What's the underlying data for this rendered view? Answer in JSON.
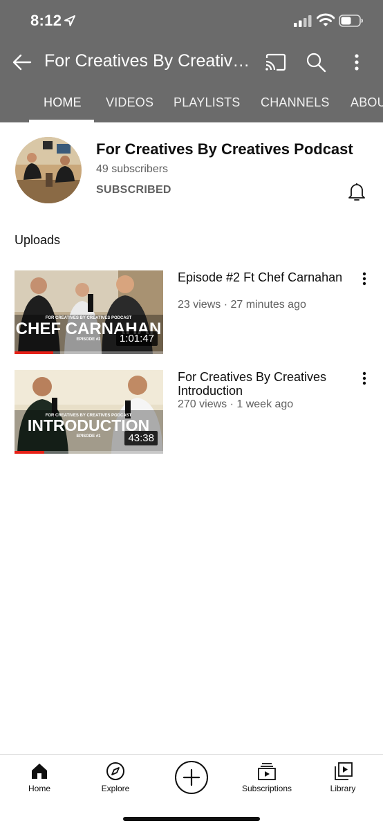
{
  "status_bar": {
    "time": "8:12"
  },
  "app_bar": {
    "title": "For Creatives By Creatives Podcast"
  },
  "tabs": [
    {
      "label": "HOME",
      "active": true
    },
    {
      "label": "VIDEOS",
      "active": false
    },
    {
      "label": "PLAYLISTS",
      "active": false
    },
    {
      "label": "CHANNELS",
      "active": false
    },
    {
      "label": "ABOUT",
      "active": false
    }
  ],
  "channel": {
    "name": "For Creatives By Creatives Podcast",
    "subscribers": "49 subscribers",
    "subscribe_state": "SUBSCRIBED"
  },
  "section": {
    "uploads_label": "Uploads"
  },
  "videos": [
    {
      "title": "Episode #2 Ft Chef Carnahan",
      "meta": "23 views · 27 minutes ago",
      "duration": "1:01:47",
      "thumb_header": "FOR CREATIVES BY CREATIVES PODCAST",
      "thumb_title": "CHEF CARNAHAN",
      "thumb_episode": "EPISODE #2",
      "watched_fraction": 0.26
    },
    {
      "title": "For Creatives By Creatives Introduction",
      "meta": "270 views · 1 week ago",
      "duration": "43:38",
      "thumb_header": "FOR CREATIVES BY CREATIVES PODCAST",
      "thumb_title": "INTRODUCTION",
      "thumb_episode": "EPISODE #1",
      "watched_fraction": 0.2
    }
  ],
  "bottom_nav": {
    "home": "Home",
    "explore": "Explore",
    "subscriptions": "Subscriptions",
    "library": "Library"
  },
  "colors": {
    "header_bg": "#6b6b6b",
    "progress_red": "#e62117",
    "secondary_text": "#606060"
  }
}
